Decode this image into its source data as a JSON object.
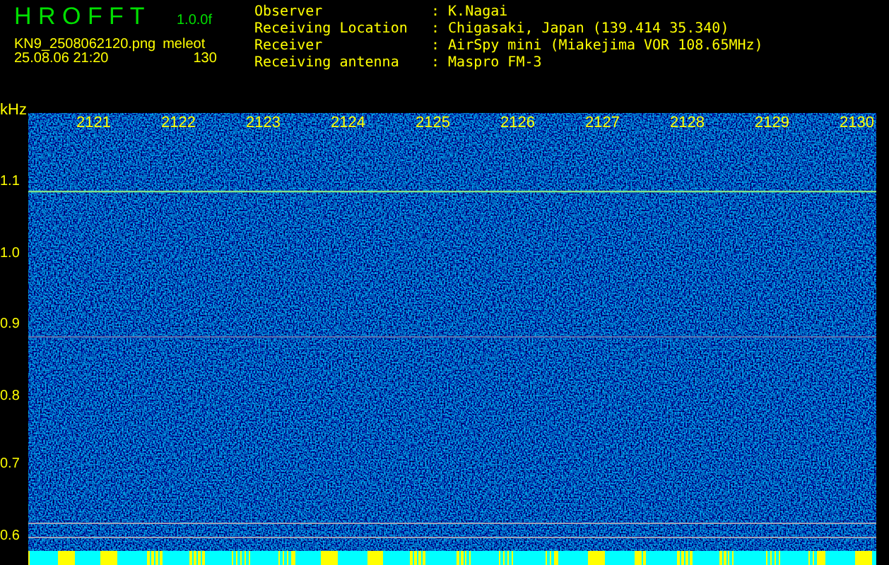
{
  "header": {
    "title": "H R O F F T",
    "version": "1.0.0f",
    "filename": "KN9_2508062120.png",
    "label": "meleot",
    "datetime": "25.08.06 21:20",
    "count": "130"
  },
  "info": [
    {
      "label": "Observer",
      "value": ": K.Nagai"
    },
    {
      "label": "Receiving Location",
      "value": ": Chigasaki, Japan (139.414 35.340)"
    },
    {
      "label": "Receiver",
      "value": ": AirSpy mini (Miakejima VOR 108.65MHz)"
    },
    {
      "label": "Receiving antenna",
      "value": ": Maspro FM-3"
    }
  ],
  "y_axis": {
    "unit": "kHz",
    "ticks": [
      "1.1",
      "1.0",
      "0.9",
      "0.8",
      "0.7",
      "0.6"
    ]
  },
  "time_marks": [
    "2121",
    "2122",
    "2123",
    "2124",
    "2125",
    "2126",
    "2127",
    "2128",
    "2129",
    "2130"
  ]
}
